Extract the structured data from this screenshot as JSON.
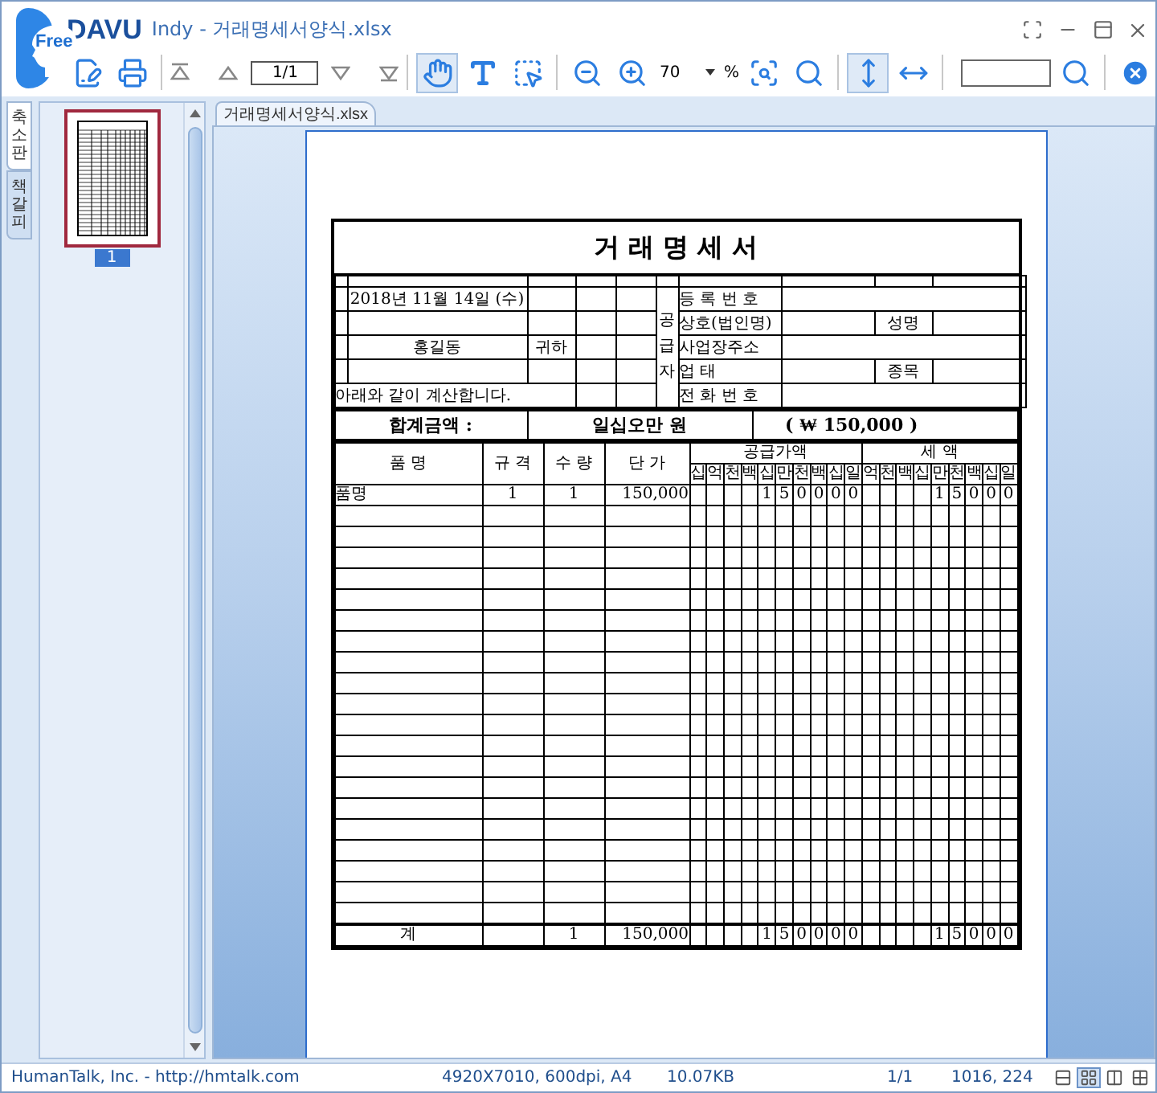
{
  "window": {
    "logo_text": "Free",
    "app_name": "DAVU",
    "title": "Indy - 거래명세서양식.xlsx"
  },
  "toolbar": {
    "page": "1/1",
    "zoom": "70",
    "zoom_unit": "%",
    "tools": [
      {
        "selected": true
      },
      {
        "selected": false
      },
      {
        "selected": false
      }
    ],
    "fit_tools": [
      {
        "selected": true
      },
      {
        "selected": false
      }
    ]
  },
  "side_tabs": [
    {
      "label": "축소판",
      "selected": true
    },
    {
      "label": "책갈피",
      "selected": false
    }
  ],
  "thumbnails": [
    {
      "label": "1",
      "selected": true
    }
  ],
  "doc_tabs": [
    {
      "label": "거래명세서양식.xlsx",
      "selected": true
    }
  ],
  "document": {
    "title": "거 래 명 세 서",
    "date": "2018년 11월 14일 (수)",
    "recipient": "홍길동",
    "honorific": "귀하",
    "note": "아래와 같이 계산합니다.",
    "supplier_label": "공급자",
    "supplier": {
      "reg_no": "등 록 번 호",
      "company": "상호(법인명)",
      "ceo": "성명",
      "address": "사업장주소",
      "business_type": "업 태",
      "item_type": "종목",
      "phone": "전 화 번 호"
    },
    "total": {
      "label": "합계금액 :",
      "words": "일십오만 원",
      "figure": "( ₩ 150,000 )"
    },
    "columns": {
      "name": "품 명",
      "spec": "규 격",
      "qty": "수 량",
      "price": "단 가",
      "supply": "공급가액",
      "tax": "세 액"
    },
    "supply_digits": [
      "십",
      "억",
      "천",
      "백",
      "십",
      "만",
      "천",
      "백",
      "십",
      "일"
    ],
    "tax_digits": [
      "억",
      "천",
      "백",
      "십",
      "만",
      "천",
      "백",
      "십",
      "일"
    ],
    "rows": [
      {
        "name": "품명",
        "spec": "1",
        "qty": "1",
        "price": "150,000",
        "supply": [
          "1",
          "5",
          "0",
          "0",
          "0",
          "0"
        ],
        "tax": [
          "1",
          "5",
          "0",
          "0",
          "0"
        ]
      }
    ],
    "footer": {
      "name": "계",
      "qty": "1",
      "price": "150,000",
      "supply": [
        "1",
        "5",
        "0",
        "0",
        "0",
        "0"
      ],
      "tax": [
        "1",
        "5",
        "0",
        "0",
        "0"
      ]
    }
  },
  "status_bar": {
    "company": "HumanTalk, Inc. - http://hmtalk.com",
    "image_info": "4920X7010, 600dpi, A4",
    "file_size": "10.07KB",
    "page": "1/1",
    "position": "1016, 224",
    "view_modes": [
      {
        "selected": false
      },
      {
        "selected": true
      },
      {
        "selected": false
      },
      {
        "selected": false
      }
    ]
  }
}
